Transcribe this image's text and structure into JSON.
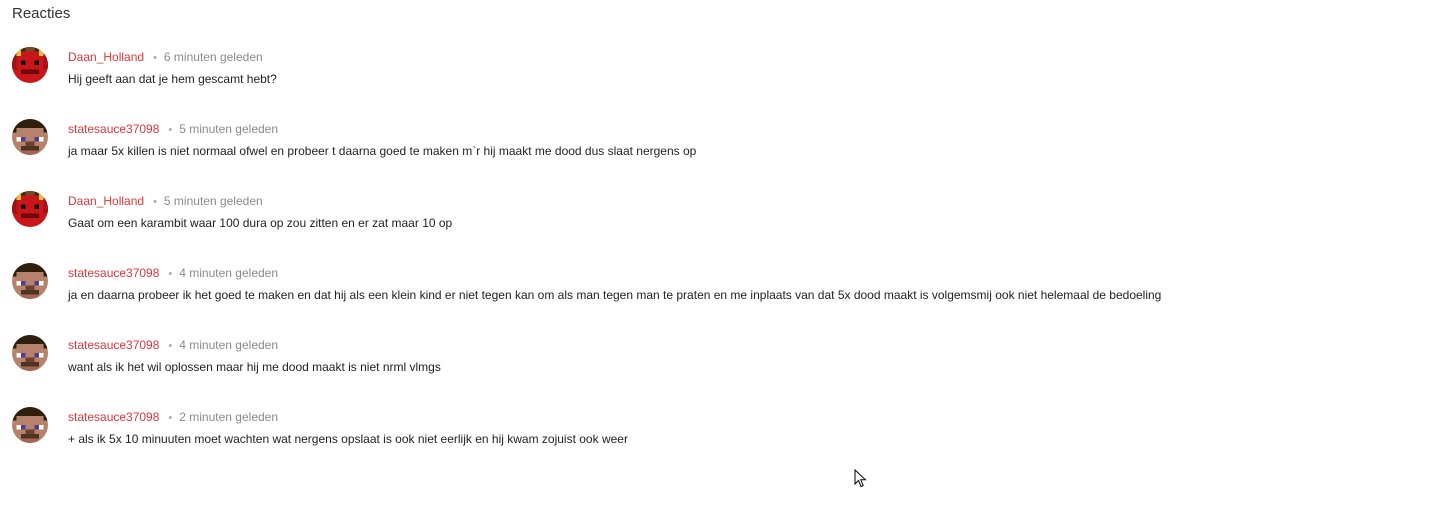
{
  "section": {
    "title": "Reacties"
  },
  "comments": [
    {
      "author": "Daan_Holland",
      "separator": "•",
      "time": "6 minuten geleden",
      "text": "Hij geeft aan dat je hem gescamt hebt?",
      "avatar_icon": "red-devil-avatar-icon"
    },
    {
      "author": "statesauce37098",
      "separator": "•",
      "time": "5 minuten geleden",
      "text": "ja maar 5x killen is niet normaal ofwel en probeer t daarna goed te maken m`r hij maakt me dood dus slaat nergens op",
      "avatar_icon": "steve-avatar-icon"
    },
    {
      "author": "Daan_Holland",
      "separator": "•",
      "time": "5 minuten geleden",
      "text": "Gaat om een karambit waar 100 dura op zou zitten en er zat maar 10 op",
      "avatar_icon": "red-devil-avatar-icon"
    },
    {
      "author": "statesauce37098",
      "separator": "•",
      "time": "4 minuten geleden",
      "text": "ja en daarna probeer ik het goed te maken en dat hij als een klein kind er niet tegen kan om als man tegen man te praten en me inplaats van dat 5x dood maakt is volgemsmij ook niet helemaal de bedoeling",
      "avatar_icon": "steve-avatar-icon"
    },
    {
      "author": "statesauce37098",
      "separator": "•",
      "time": "4 minuten geleden",
      "text": "want als ik het wil oplossen maar hij me dood maakt is niet nrml vlmgs",
      "avatar_icon": "steve-avatar-icon"
    },
    {
      "author": "statesauce37098",
      "separator": "•",
      "time": "2 minuten geleden",
      "text": "+ als ik 5x 10 minuuten moet wachten wat nergens opslaat is ook niet eerlijk en hij kwam zojuist ook weer",
      "avatar_icon": "steve-avatar-icon"
    }
  ],
  "colors": {
    "author": "#e0353b",
    "time": "#8a8a8a",
    "text": "#222222"
  }
}
